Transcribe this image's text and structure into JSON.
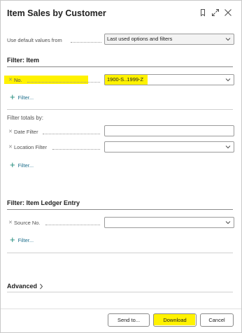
{
  "dialog": {
    "title": "Item Sales by Customer"
  },
  "defaults": {
    "label": "Use default values from",
    "value": "Last used options and filters"
  },
  "filter_item": {
    "heading": "Filter: Item",
    "no_label": "No.",
    "no_value": "1900-S..1999-Z",
    "add_filter": "Filter..."
  },
  "filter_totals": {
    "heading": "Filter totals by:",
    "date_label": "Date Filter",
    "date_value": "",
    "location_label": "Location Filter",
    "location_value": "",
    "add_filter": "Filter..."
  },
  "filter_ledger": {
    "heading": "Filter: Item Ledger Entry",
    "source_label": "Source No.",
    "source_value": "",
    "add_filter": "Filter..."
  },
  "advanced": {
    "label": "Advanced"
  },
  "footer": {
    "send_to": "Send to...",
    "download": "Download",
    "cancel": "Cancel"
  },
  "colors": {
    "highlight": "#fff200",
    "link": "#1e6e8c",
    "plus": "#1e8a7a"
  }
}
